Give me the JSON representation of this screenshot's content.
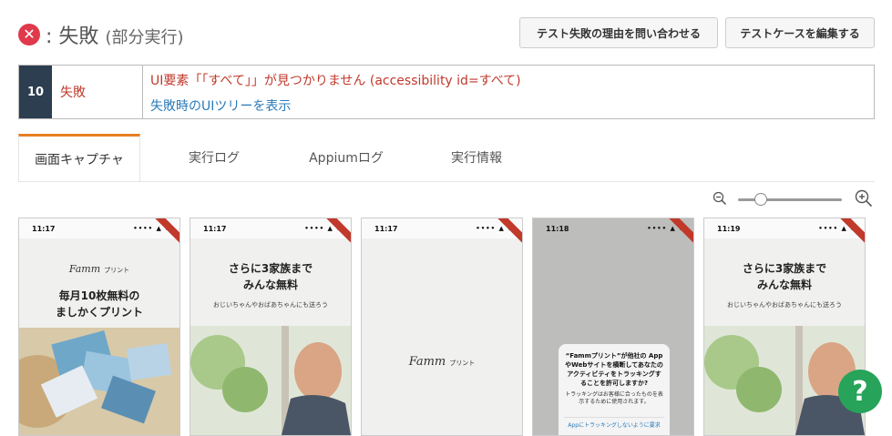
{
  "header": {
    "separator": ":",
    "title": "失敗",
    "subtitle": "(部分実行)"
  },
  "buttons": {
    "inquire": "テスト失敗の理由を問い合わせる",
    "edit_testcase": "テストケースを編集する"
  },
  "result": {
    "step": "10",
    "status": "失敗",
    "error": "UI要素「「すべて」」が見つかりません (accessibility id=すべて)",
    "show_tree": "失敗時のUIツリーを表示"
  },
  "tabs": [
    {
      "label": "画面キャプチャ"
    },
    {
      "label": "実行ログ"
    },
    {
      "label": "Appiumログ"
    },
    {
      "label": "実行情報"
    }
  ],
  "screenshots": [
    {
      "time": "11:17",
      "brand": "Famm",
      "brand_sub": "プリント",
      "line1": "毎月10枚無料の",
      "line2": "ましかくプリント"
    },
    {
      "time": "11:17",
      "line1": "さらに3家族まで",
      "line2": "みんな無料",
      "sub": "おじいちゃんやおばあちゃんにも送ろう"
    },
    {
      "time": "11:17",
      "brand": "Famm",
      "brand_sub": "プリント"
    },
    {
      "time": "11:18",
      "dialog_title": "“Fammプリント”が他社の AppやWebサイトを横断してあなたのアクティビティをトラッキングすることを許可しますか?",
      "dialog_small": "トラッキングはお客様に合ったものを表示するために使用されます。",
      "dialog_deny": "Appにトラッキングしないように要求"
    },
    {
      "time": "11:19",
      "line1": "さらに3家族まで",
      "line2": "みんな無料",
      "sub": "おじいちゃんやおばあちゃんにも送ろう"
    }
  ],
  "zoom": {
    "level": 0.3
  },
  "colors": {
    "fail": "#e0394b",
    "tab_accent": "#e67e22",
    "step_bg": "#2c3e50",
    "help": "#27a35a"
  }
}
